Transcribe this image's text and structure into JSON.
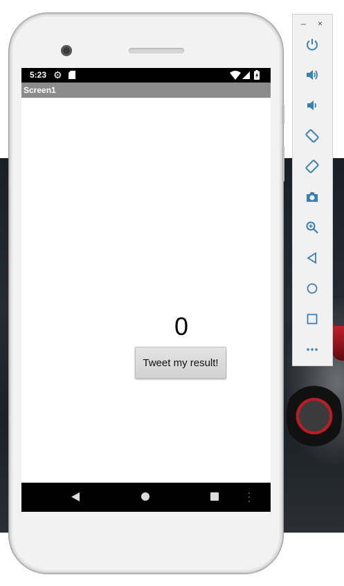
{
  "phone": {
    "status_bar": {
      "time": "5:23",
      "icons": [
        "gear-icon",
        "sd-card-icon",
        "wifi-icon",
        "signal-icon",
        "battery-icon"
      ]
    },
    "app": {
      "title": "Screen1",
      "counter_value": "0",
      "tweet_button_label": "Tweet my result!"
    },
    "nav_bar": {
      "buttons": [
        "back-icon",
        "home-icon",
        "recents-icon",
        "more-icon"
      ]
    }
  },
  "emulator_panel": {
    "window_controls": {
      "minimize": "–",
      "close": "×"
    },
    "buttons": [
      "power-icon",
      "volume-up-icon",
      "volume-down-icon",
      "rotate-left-icon",
      "rotate-right-icon",
      "camera-icon",
      "zoom-icon",
      "back-icon",
      "home-icon",
      "overview-icon",
      "more-icon"
    ]
  },
  "colors": {
    "accent_icon": "#3c7fb1",
    "title_bar": "#8c8c8c",
    "screen_bg": "#ffffff",
    "nav_bar": "#000000"
  }
}
